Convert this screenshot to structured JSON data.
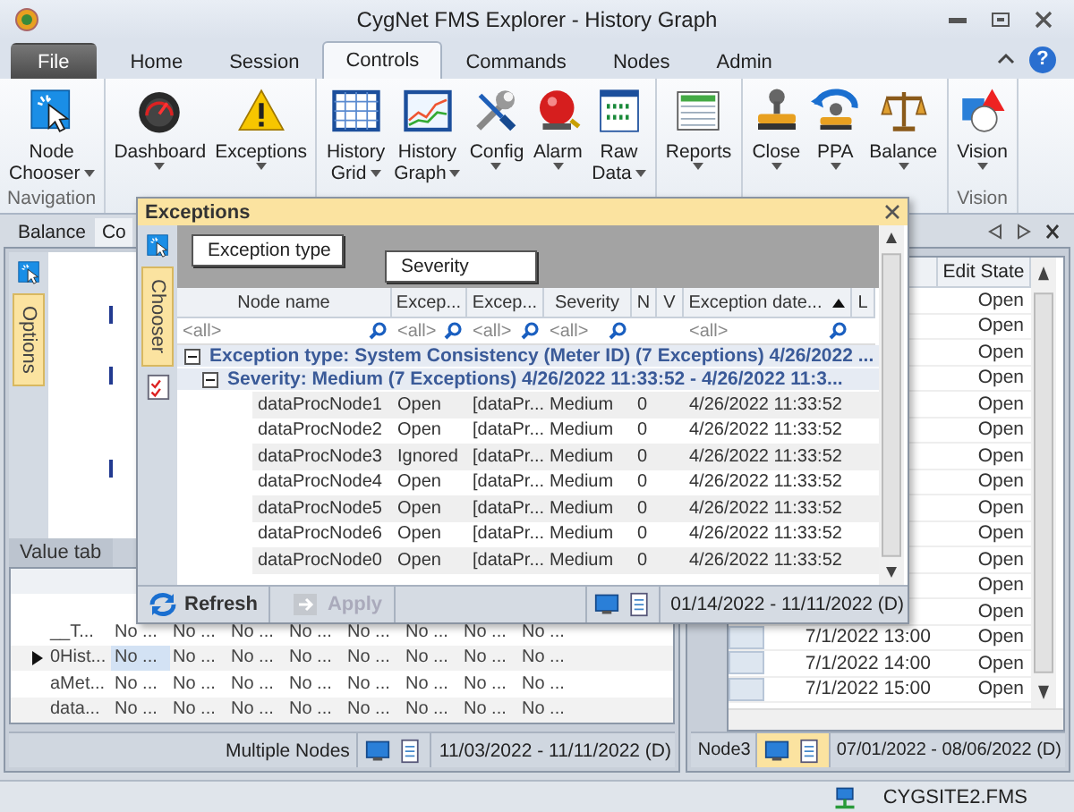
{
  "window": {
    "title": "CygNet FMS Explorer - History Graph"
  },
  "menu_tabs": [
    {
      "label": "File",
      "kind": "file",
      "selected": false
    },
    {
      "label": "Home",
      "kind": "tab",
      "selected": false
    },
    {
      "label": "Session",
      "kind": "tab",
      "selected": false
    },
    {
      "label": "Controls",
      "kind": "tab",
      "selected": true
    },
    {
      "label": "Commands",
      "kind": "tab",
      "selected": false
    },
    {
      "label": "Nodes",
      "kind": "tab",
      "selected": false
    },
    {
      "label": "Admin",
      "kind": "tab",
      "selected": false
    }
  ],
  "help": "?",
  "ribbon": {
    "groups": [
      {
        "label": "Navigation",
        "buttons": [
          {
            "lines": [
              "Node",
              "Chooser"
            ],
            "dropdown": true
          }
        ]
      },
      {
        "buttons": [
          {
            "lines": [
              "Dashboard"
            ],
            "dropdown": true
          },
          {
            "lines": [
              "Exceptions"
            ],
            "dropdown": true
          }
        ]
      },
      {
        "buttons": [
          {
            "lines": [
              "History",
              "Grid"
            ],
            "dropdown": true
          },
          {
            "lines": [
              "History",
              "Graph"
            ],
            "dropdown": true
          },
          {
            "lines": [
              "Config"
            ],
            "dropdown": true
          },
          {
            "lines": [
              "Alarm"
            ],
            "dropdown": true
          },
          {
            "lines": [
              "Raw",
              "Data"
            ],
            "dropdown": true
          }
        ]
      },
      {
        "buttons": [
          {
            "lines": [
              "Reports"
            ],
            "dropdown": true
          }
        ]
      },
      {
        "buttons": [
          {
            "lines": [
              "Close"
            ],
            "dropdown": true
          },
          {
            "lines": [
              "PPA"
            ],
            "dropdown": true
          },
          {
            "lines": [
              "Balance"
            ],
            "dropdown": true
          }
        ]
      },
      {
        "label": "Vision",
        "buttons": [
          {
            "lines": [
              "Vision"
            ],
            "dropdown": true
          }
        ]
      }
    ]
  },
  "left_panel": {
    "tabs": [
      {
        "label": "Balance",
        "selected": false
      },
      {
        "label": "Co",
        "selected": true
      }
    ],
    "side_tab": "Options",
    "value_tab": "Value tab",
    "rows": [
      {
        "name": "__T...",
        "selected": false,
        "cells": [
          "No ...",
          "No ...",
          "No ...",
          "No ...",
          "No ...",
          "No ...",
          "No ...",
          "No ..."
        ]
      },
      {
        "name": "0Hist...",
        "selected": true,
        "cells": [
          "No ...",
          "No ...",
          "No ...",
          "No ...",
          "No ...",
          "No ...",
          "No ...",
          "No ..."
        ]
      },
      {
        "name": "aMet...",
        "selected": false,
        "cells": [
          "No ...",
          "No ...",
          "No ...",
          "No ...",
          "No ...",
          "No ...",
          "No ...",
          "No ..."
        ]
      },
      {
        "name": "data...",
        "selected": false,
        "cells": [
          "No ...",
          "No ...",
          "No ...",
          "No ...",
          "No ...",
          "No ...",
          "No ...",
          "No ..."
        ]
      }
    ],
    "status": {
      "nodes": "Multiple Nodes",
      "range": "11/03/2022 - 11/11/2022 (D)"
    }
  },
  "right_panel": {
    "column": "Edit State",
    "rows": [
      {
        "state": "Open"
      },
      {
        "state": "Open"
      },
      {
        "state": "Open"
      },
      {
        "state": "Open"
      },
      {
        "state": "Open"
      },
      {
        "state": "Open"
      },
      {
        "state": "Open"
      },
      {
        "state": "Open"
      },
      {
        "state": "Open"
      },
      {
        "state": "Open"
      },
      {
        "state": "Open"
      },
      {
        "state": "Open"
      },
      {
        "state": "Open"
      },
      {
        "time": "7/1/2022 13:00",
        "state": "Open"
      },
      {
        "time": "7/1/2022 14:00",
        "state": "Open"
      },
      {
        "time": "7/1/2022 15:00",
        "state": "Open"
      }
    ],
    "status": {
      "node": "Node3",
      "range": "07/01/2022 - 08/06/2022 (D)"
    }
  },
  "exceptions": {
    "title": "Exceptions",
    "side_tab": "Chooser",
    "group_by": [
      "Exception type",
      "Severity"
    ],
    "columns": [
      {
        "label": "Node name",
        "filter": "<all>"
      },
      {
        "label": "Excep...",
        "filter": "<all>"
      },
      {
        "label": "Excep...",
        "filter": "<all>"
      },
      {
        "label": "Severity",
        "filter": "<all>"
      },
      {
        "label": "N"
      },
      {
        "label": "V"
      },
      {
        "label": "Exception date...",
        "filter": "<all>",
        "sorted": true
      },
      {
        "label": "L"
      }
    ],
    "groups": [
      {
        "label": "Exception type: System Consistency (Meter ID) (7 Exceptions) 4/26/2022 ...",
        "expanded": true,
        "children": [
          {
            "label": "Severity: Medium (7 Exceptions) 4/26/2022 11:33:52 - 4/26/2022 11:3...",
            "expanded": true,
            "rows": [
              {
                "node": "dataProcNode1",
                "status": "Open",
                "description": "[dataPr...",
                "severity": "Medium",
                "n": "0",
                "date": "4/26/2022 11:33:52"
              },
              {
                "node": "dataProcNode2",
                "status": "Open",
                "description": "[dataPr...",
                "severity": "Medium",
                "n": "0",
                "date": "4/26/2022 11:33:52"
              },
              {
                "node": "dataProcNode3",
                "status": "Ignored",
                "description": "[dataPr...",
                "severity": "Medium",
                "n": "0",
                "date": "4/26/2022 11:33:52"
              },
              {
                "node": "dataProcNode4",
                "status": "Open",
                "description": "[dataPr...",
                "severity": "Medium",
                "n": "0",
                "date": "4/26/2022 11:33:52"
              },
              {
                "node": "dataProcNode5",
                "status": "Open",
                "description": "[dataPr...",
                "severity": "Medium",
                "n": "0",
                "date": "4/26/2022 11:33:52"
              },
              {
                "node": "dataProcNode6",
                "status": "Open",
                "description": "[dataPr...",
                "severity": "Medium",
                "n": "0",
                "date": "4/26/2022 11:33:52"
              },
              {
                "node": "dataProcNode0",
                "status": "Open",
                "description": "[dataPr...",
                "severity": "Medium",
                "n": "0",
                "date": "4/26/2022 11:33:52"
              }
            ]
          }
        ]
      }
    ],
    "footer": {
      "refresh": "Refresh",
      "apply": {
        "label": "Apply",
        "disabled": true
      },
      "range": "01/14/2022 - 11/11/2022 (D)"
    }
  },
  "status_bar": {
    "server": "CYGSITE2.FMS"
  }
}
